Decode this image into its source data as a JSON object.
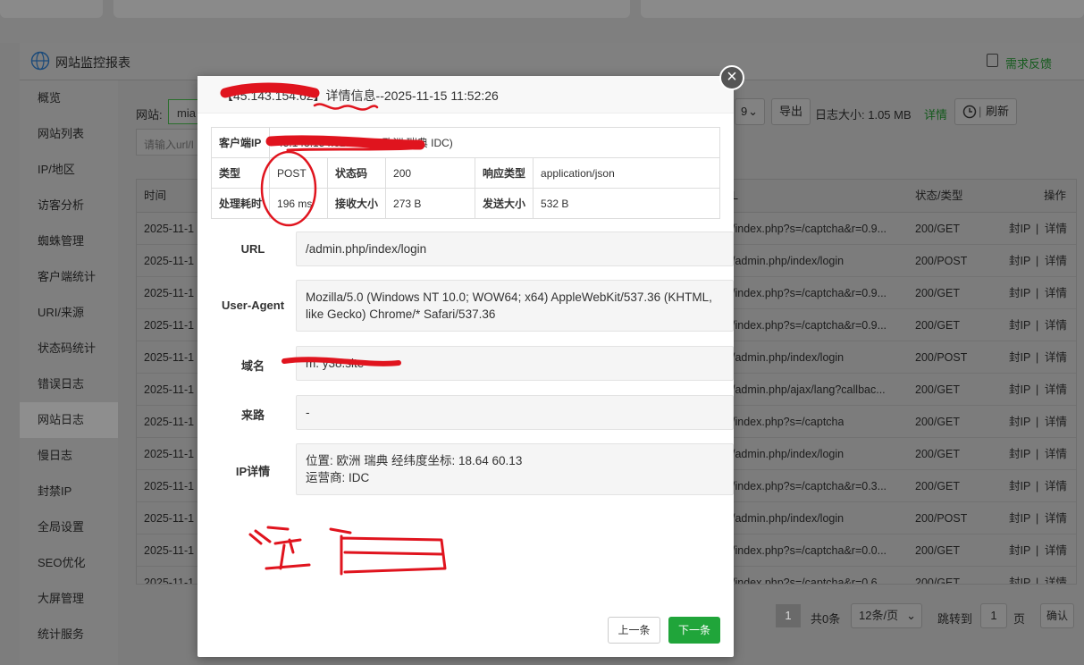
{
  "panel": {
    "title": "网站监控报表",
    "feedback": "需求反馈"
  },
  "sidebar": {
    "items": [
      {
        "label": "概览"
      },
      {
        "label": "网站列表"
      },
      {
        "label": "IP/地区"
      },
      {
        "label": "访客分析"
      },
      {
        "label": "蜘蛛管理"
      },
      {
        "label": "客户端统计"
      },
      {
        "label": "URI/来源"
      },
      {
        "label": "状态码统计"
      },
      {
        "label": "错误日志"
      },
      {
        "label": "网站日志",
        "active": true
      },
      {
        "label": "慢日志"
      },
      {
        "label": "封禁IP"
      },
      {
        "label": "全局设置"
      },
      {
        "label": "SEO优化"
      },
      {
        "label": "大屏管理"
      },
      {
        "label": "统计服务"
      }
    ]
  },
  "toolbar": {
    "site_label": "网站:",
    "site_value": "mia",
    "search_placeholder": "请输入url/I",
    "export": "导出",
    "log_size": "日志大小: 1.05 MB",
    "details": "详情",
    "refresh": "刷新",
    "dropdown_partial": "9"
  },
  "table": {
    "headers": {
      "time": "时间",
      "url": "L",
      "status": "状态/类型",
      "actions": "操作"
    },
    "ban": "封IP",
    "detail": "详情",
    "sep": "|",
    "rows": [
      {
        "time": "2025-11-1",
        "url": "/index.php?s=/captcha&r=0.9...",
        "status": "200/GET"
      },
      {
        "time": "2025-11-1",
        "url": "/admin.php/index/login",
        "status": "200/POST"
      },
      {
        "time": "2025-11-1",
        "url": "/index.php?s=/captcha&r=0.9...",
        "status": "200/GET"
      },
      {
        "time": "2025-11-1",
        "url": "/index.php?s=/captcha&r=0.9...",
        "status": "200/GET"
      },
      {
        "time": "2025-11-1",
        "url": "/admin.php/index/login",
        "status": "200/POST"
      },
      {
        "time": "2025-11-1",
        "url": "/admin.php/ajax/lang?callbac...",
        "status": "200/GET"
      },
      {
        "time": "2025-11-1",
        "url": "/index.php?s=/captcha",
        "status": "200/GET"
      },
      {
        "time": "2025-11-1",
        "url": "/admin.php/index/login",
        "status": "200/GET"
      },
      {
        "time": "2025-11-1",
        "url": "/index.php?s=/captcha&r=0.3...",
        "status": "200/GET"
      },
      {
        "time": "2025-11-1",
        "url": "/admin.php/index/login",
        "status": "200/POST"
      },
      {
        "time": "2025-11-1",
        "url": "/index.php?s=/captcha&r=0.0...",
        "status": "200/GET"
      },
      {
        "time": "2025-11-1",
        "url": "/index.php?s=/captcha&r=0.6...",
        "status": "200/GET"
      }
    ]
  },
  "pager": {
    "current": "1",
    "total": "共0条",
    "per_page": "12条/页",
    "jump_label": "跳转到",
    "jump_value": "1",
    "page_unit": "页",
    "confirm": "确认"
  },
  "modal": {
    "title_ip": "【45.143.154.62】",
    "title_text": "详情信息--2025-11-15 11:52:26",
    "client_ip_label": "客户端IP",
    "client_ip_value": "45.143.154.62:56758(欧洲 瑞典 IDC)",
    "type_label": "类型",
    "type_value": "POST",
    "status_label": "状态码",
    "status_value": "200",
    "resp_type_label": "响应类型",
    "resp_type_value": "application/json",
    "time_label": "处理耗时",
    "time_value": "196 ms",
    "recv_label": "接收大小",
    "recv_value": "273 B",
    "send_label": "发送大小",
    "send_value": "532 B",
    "url_label": "URL",
    "url_value": "/admin.php/index/login",
    "ua_label": "User-Agent",
    "ua_value": "Mozilla/5.0 (Windows NT 10.0; WOW64; x64) AppleWebKit/537.36 (KHTML, like Gecko) Chrome/* Safari/537.36",
    "domain_label": "域名",
    "domain_value": "m.         y38.site",
    "referer_label": "来路",
    "referer_value": "-",
    "ipinfo_label": "IP详情",
    "ipinfo_location": "位置: 欧洲 瑞典 经纬度坐标: 18.64 60.13",
    "ipinfo_isp": "运营商:  IDC",
    "prev": "上一条",
    "next": "下一条",
    "close": "×"
  },
  "colors": {
    "accent": "#20a53a",
    "annotation": "#e0141e"
  }
}
